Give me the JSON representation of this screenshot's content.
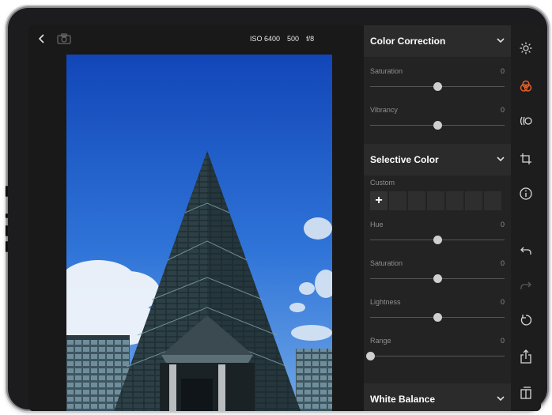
{
  "viewer": {
    "exif": {
      "iso": "ISO 6400",
      "shutter": "500",
      "aperture": "f/8"
    },
    "icons": [
      "back-icon",
      "camera-icon"
    ]
  },
  "panel": {
    "color_correction": {
      "title": "Color Correction",
      "saturation": {
        "label": "Saturation",
        "value": "0",
        "level": 0.5
      },
      "vibrancy": {
        "label": "Vibrancy",
        "value": "0",
        "level": 0.5
      }
    },
    "selective_color": {
      "title": "Selective Color",
      "custom_label": "Custom",
      "add_label": "+",
      "hue": {
        "label": "Hue",
        "value": "0",
        "level": 0.5
      },
      "saturation": {
        "label": "Saturation",
        "value": "0",
        "level": 0.5
      },
      "lightness": {
        "label": "Lightness",
        "value": "0",
        "level": 0.5
      },
      "range": {
        "label": "Range",
        "value": "0",
        "level": 0.0
      }
    },
    "white_balance": {
      "title": "White Balance"
    }
  },
  "toolbar": {
    "tools": [
      "brightness-icon",
      "color-icon",
      "lens-icon",
      "crop-icon",
      "info-icon",
      "undo-icon",
      "redo-icon",
      "reset-icon",
      "share-icon",
      "compare-icon"
    ],
    "accent": "#e8622c"
  },
  "colors": {
    "panel_bg": "#232323",
    "header_bg": "#2b2b2b",
    "sky": "#1f5fd0"
  }
}
